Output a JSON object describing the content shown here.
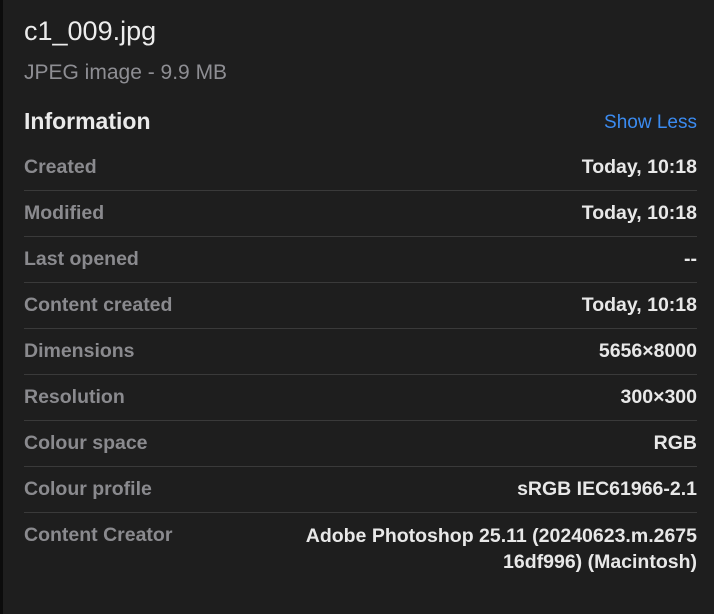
{
  "file": {
    "name": "c1_009.jpg",
    "kind": "JPEG image - 9.9 MB"
  },
  "information": {
    "title": "Information",
    "toggle_label": "Show Less",
    "rows": [
      {
        "label": "Created",
        "value": "Today, 10:18"
      },
      {
        "label": "Modified",
        "value": "Today, 10:18"
      },
      {
        "label": "Last opened",
        "value": "--"
      },
      {
        "label": "Content created",
        "value": "Today, 10:18"
      },
      {
        "label": "Dimensions",
        "value": "5656×8000"
      },
      {
        "label": "Resolution",
        "value": "300×300"
      },
      {
        "label": "Colour space",
        "value": "RGB"
      },
      {
        "label": "Colour profile",
        "value": "sRGB IEC61966-2.1"
      },
      {
        "label": "Content Creator",
        "value_line1": "Adobe Photoshop 25.11 (20240623.m.2675",
        "value_line2": "16df996)  (Macintosh)"
      }
    ]
  },
  "colors": {
    "background": "#1e1e1e",
    "link": "#3b8bf0",
    "label": "#8a8a8e",
    "value": "#e8e8e8"
  }
}
